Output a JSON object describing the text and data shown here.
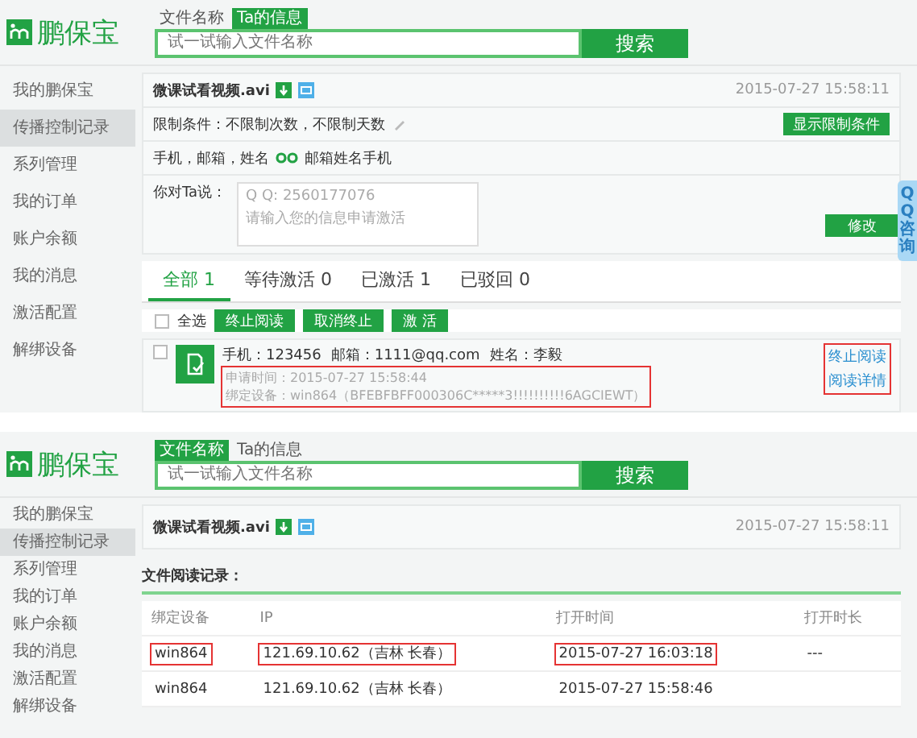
{
  "panels": [
    {
      "kind": "requests",
      "logo": "鹏保宝",
      "search": {
        "tabs": [
          {
            "label": "文件名称",
            "selected": false
          },
          {
            "label": "Ta的信息",
            "selected": true
          }
        ],
        "placeholder": "试一试输入文件名称",
        "button": "搜索"
      },
      "sidebar": [
        {
          "label": "我的鹏保宝",
          "selected": false
        },
        {
          "label": "传播控制记录",
          "selected": true
        },
        {
          "label": "系列管理",
          "selected": false
        },
        {
          "label": "我的订单",
          "selected": false
        },
        {
          "label": "账户余额",
          "selected": false
        },
        {
          "label": "我的消息",
          "selected": false
        },
        {
          "label": "激活配置",
          "selected": false
        },
        {
          "label": "解绑设备",
          "selected": false
        }
      ],
      "file": {
        "name": "微课试看视频.avi",
        "time": "2015-07-27 15:58:11"
      },
      "limit": {
        "text": "限制条件：不限制次数，不限制天数",
        "button": "显示限制条件"
      },
      "contact": {
        "label": "手机，邮箱，姓名",
        "value": "邮箱姓名手机"
      },
      "message": {
        "label": "你对Ta说：",
        "qq": "Q Q:  2560177076",
        "hint": "请输入您的信息申请激活",
        "button": "修改"
      },
      "tabs": [
        {
          "label": "全部 1",
          "selected": true
        },
        {
          "label": "等待激活 0",
          "selected": false
        },
        {
          "label": "已激活 1",
          "selected": false
        },
        {
          "label": "已驳回 0",
          "selected": false
        }
      ],
      "select_all": {
        "label": "全选",
        "checked": false
      },
      "actions": [
        "终止阅读",
        "取消终止",
        "激 活"
      ],
      "requests": [
        {
          "checked": false,
          "phone": "手机：123456",
          "email": "邮箱：1111@qq.com",
          "name": "姓名：李毅",
          "applied": "申请时间：2015-07-27 15:58:44",
          "device": "绑定设备：win864（BFEBFBFF000306C*****3!!!!!!!!!!6AGCIEWT）",
          "highlighted": true,
          "links": [
            "终止阅读",
            "阅读详情"
          ],
          "links_highlighted": true
        }
      ],
      "side_tab": "QQ咨询"
    },
    {
      "kind": "log",
      "logo": "鹏保宝",
      "search": {
        "tabs": [
          {
            "label": "文件名称",
            "selected": true
          },
          {
            "label": "Ta的信息",
            "selected": false
          }
        ],
        "placeholder": "试一试输入文件名称",
        "button": "搜索"
      },
      "sidebar": [
        {
          "label": "我的鹏保宝",
          "selected": false
        },
        {
          "label": "传播控制记录",
          "selected": true
        },
        {
          "label": "系列管理",
          "selected": false
        },
        {
          "label": "我的订单",
          "selected": false
        },
        {
          "label": "账户余额",
          "selected": false
        },
        {
          "label": "我的消息",
          "selected": false
        },
        {
          "label": "激活配置",
          "selected": false
        },
        {
          "label": "解绑设备",
          "selected": false
        }
      ],
      "file": {
        "name": "微课试看视频.avi",
        "time": "2015-07-27 15:58:11"
      },
      "log": {
        "title": "文件阅读记录：",
        "columns": [
          "绑定设备",
          "IP",
          "打开时间",
          "打开时长"
        ],
        "rows": [
          {
            "cells": [
              {
                "text": "win864",
                "highlighted": true
              },
              {
                "text": "121.69.10.62（吉林 长春）",
                "highlighted": true
              },
              {
                "text": "2015-07-27 16:03:18",
                "highlighted": true
              },
              {
                "text": "---",
                "highlighted": false
              }
            ]
          },
          {
            "cells": [
              {
                "text": "win864",
                "highlighted": false
              },
              {
                "text": "121.69.10.62（吉林 长春）",
                "highlighted": false
              },
              {
                "text": "2015-07-27 15:58:46",
                "highlighted": false
              }
            ]
          }
        ]
      }
    }
  ]
}
